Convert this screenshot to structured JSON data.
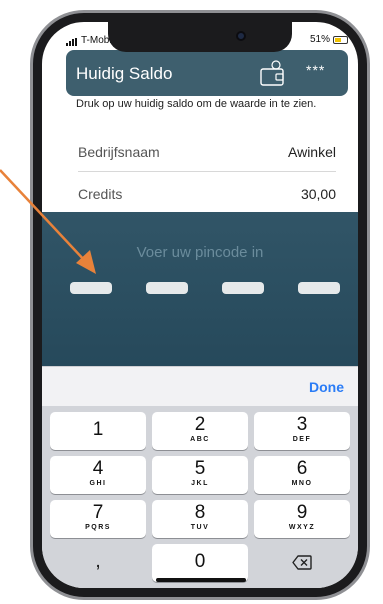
{
  "status_bar": {
    "carrier": "T-Mobile NL",
    "battery": "51%",
    "battery_level": 0.51,
    "battery_color": "#f2c300"
  },
  "header": {
    "title": "Huidig Saldo",
    "balance_masked": "***",
    "icon": "wallet-icon",
    "bg_color": "#3e5f6e"
  },
  "hint": "Druk op uw huidig saldo om de waarde in te zien.",
  "details": [
    {
      "label": "Bedrijfsnaam",
      "value": "Awinkel"
    },
    {
      "label": "Credits",
      "value": "30,00"
    }
  ],
  "pin": {
    "prompt": "Voer uw pincode in",
    "slots": 4
  },
  "keyboard": {
    "done_label": "Done",
    "keys": [
      {
        "digit": "1",
        "letters": ""
      },
      {
        "digit": "2",
        "letters": "ABC"
      },
      {
        "digit": "3",
        "letters": "DEF"
      },
      {
        "digit": "4",
        "letters": "GHI"
      },
      {
        "digit": "5",
        "letters": "JKL"
      },
      {
        "digit": "6",
        "letters": "MNO"
      },
      {
        "digit": "7",
        "letters": "PQRS"
      },
      {
        "digit": "8",
        "letters": "TUV"
      },
      {
        "digit": "9",
        "letters": "WXYZ"
      },
      {
        "digit": ",",
        "letters": ""
      },
      {
        "digit": "0",
        "letters": ""
      }
    ],
    "delete_icon": "backspace-icon"
  },
  "annotation": {
    "color": "#e8823a"
  }
}
